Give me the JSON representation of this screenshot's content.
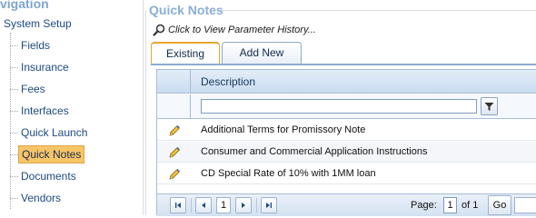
{
  "navigation": {
    "title": "vigation",
    "root_label": "System Setup",
    "items": [
      {
        "label": "Fields",
        "selected": false
      },
      {
        "label": "Insurance",
        "selected": false
      },
      {
        "label": "Fees",
        "selected": false
      },
      {
        "label": "Interfaces",
        "selected": false
      },
      {
        "label": "Quick Launch",
        "selected": false
      },
      {
        "label": "Quick Notes",
        "selected": true
      },
      {
        "label": "Documents",
        "selected": false
      },
      {
        "label": "Vendors",
        "selected": false
      }
    ]
  },
  "main": {
    "title": "Quick Notes",
    "history_link": "Click to View Parameter History...",
    "tabs": [
      {
        "label": "Existing",
        "active": true
      },
      {
        "label": "Add New",
        "active": false
      }
    ]
  },
  "grid": {
    "column_header": "Description",
    "filter_value": "",
    "rows": [
      {
        "description": "Additional Terms for Promissory Note",
        "icon": "pencil-edit-icon"
      },
      {
        "description": "Consumer and Commercial Application Instructions",
        "icon": "pencil-edit-icon"
      },
      {
        "description": "CD Special Rate of 10% with 1MM loan",
        "icon": "pencil-edit-icon"
      }
    ]
  },
  "pager": {
    "current_page_button": "1",
    "page_label": "Page:",
    "page_input_value": "1",
    "of_label": "of 1",
    "go_label": "Go"
  },
  "colors": {
    "accent_orange": "#e6a632",
    "selected_nav_bg": "#f6c568",
    "header_blue": "#cbdcf0",
    "title_blue": "#8aaed6"
  }
}
